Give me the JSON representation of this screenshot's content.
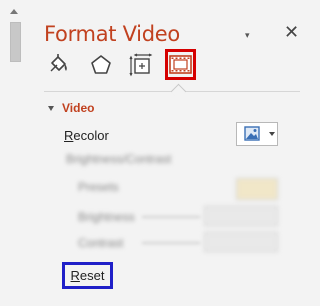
{
  "pane": {
    "title": "Format Video",
    "close_glyph": "✕",
    "menu_caret": "▾"
  },
  "tabs": [
    {
      "name": "Fill & Line",
      "icon": "paint-bucket-icon",
      "selected": false
    },
    {
      "name": "Effects",
      "icon": "pentagon-icon",
      "selected": false
    },
    {
      "name": "Size & Properties",
      "icon": "size-properties-icon",
      "selected": false
    },
    {
      "name": "Video",
      "icon": "film-strip-icon",
      "selected": true
    }
  ],
  "section": {
    "title": "Video",
    "expanded": true
  },
  "recolor": {
    "label_first": "R",
    "label_rest": "ecolor",
    "icon": "picture-icon"
  },
  "blurred": {
    "brightness_contrast": "Brightness/Contrast",
    "presets": "Presets",
    "brightness": "Brightness",
    "contrast": "Contrast"
  },
  "reset": {
    "label_first": "R",
    "label_rest": "eset"
  },
  "colors": {
    "title": "#c1411f",
    "video_tab_highlight": "#d50000",
    "reset_highlight": "#1f1fc8"
  }
}
